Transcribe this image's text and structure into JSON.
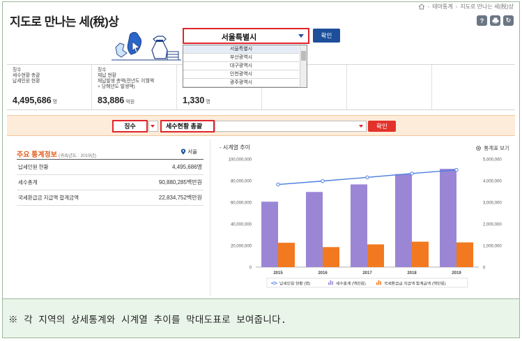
{
  "page": {
    "title": "지도로 만나는 세(稅)상"
  },
  "breadcrumb": [
    "테마통계",
    "지도로 만나는 세(稅)상"
  ],
  "toolbar": {
    "icons": [
      "help-icon",
      "print-icon",
      "refresh-icon"
    ],
    "help_glyph": "?",
    "refresh_glyph": "↻"
  },
  "region": {
    "selected": "서울특별시",
    "confirm_label": "확인",
    "options": [
      "서울특별시",
      "부산광역시",
      "대구광역시",
      "인천광역시",
      "광주광역시"
    ]
  },
  "stats": [
    {
      "label": "징수\n세수현황 총괄\n납세인원 현황",
      "value": "4,495,686",
      "unit": "명"
    },
    {
      "label": "징수\n체납 현황\n체납발생 총액(전년도 이월액\n+ 당해년도 발생액)",
      "value": "83,886",
      "unit": "억원"
    },
    {
      "label": "",
      "value": "1,330",
      "unit": "명"
    }
  ],
  "filter": {
    "type": "징수",
    "stat": "세수현황 총괄",
    "confirm_label": "확인"
  },
  "summary": {
    "title": "주요 통계정보",
    "subtitle": "(귀속년도 : 2019년)",
    "location": "서울",
    "rows": [
      {
        "label": "납세인원 현황",
        "value": "4,495,686명"
      },
      {
        "label": "세수총계",
        "value": "90,880,285백만원"
      },
      {
        "label": "국세환급금 지급액 합계금액",
        "value": "22,834,752백만원"
      }
    ]
  },
  "chart_header": {
    "title": "- 시계열 추이",
    "table_button": "통계표 보기"
  },
  "colors": {
    "accent_red": "#e0242b",
    "brand_blue": "#1d4e9a",
    "bar_purple": "#9b86d6",
    "bar_orange": "#f2791f",
    "line_blue": "#4a7fe0",
    "filter_bg": "#fdecd9",
    "note_bg": "#eaf5ea"
  },
  "chart_data": {
    "type": "bar",
    "categories": [
      "2015",
      "2016",
      "2017",
      "2018",
      "2019"
    ],
    "y_left_ticks": [
      "0",
      "20,000,000",
      "40,000,000",
      "60,000,000",
      "80,000,000",
      "100,000,000"
    ],
    "y_right_ticks": [
      "0",
      "1,000,000",
      "2,000,000",
      "3,000,000",
      "4,000,000",
      "5,000,000"
    ],
    "ylim_left": [
      0,
      100000000
    ],
    "ylim_right": [
      0,
      5000000
    ],
    "series": [
      {
        "name": "세수총계 (백만원)",
        "kind": "bar",
        "axis": "left",
        "color": "#9b86d6",
        "values": [
          60500000,
          69500000,
          76500000,
          86000000,
          90880285
        ]
      },
      {
        "name": "국세환급금 지급액 합계금액 (백만원)",
        "kind": "bar",
        "axis": "left",
        "color": "#f2791f",
        "values": [
          22500000,
          18500000,
          21000000,
          23500000,
          22834752
        ]
      },
      {
        "name": "납세인원 현황 (명)",
        "kind": "line",
        "axis": "right",
        "color": "#4a7fe0",
        "values": [
          3820000,
          3980000,
          4150000,
          4330000,
          4495686
        ]
      }
    ],
    "legend_position": "bottom",
    "grid": false
  },
  "footer": {
    "note": "※ 각 지역의 상세통계와 시계열 추이를 막대도표로 보여줍니다."
  }
}
